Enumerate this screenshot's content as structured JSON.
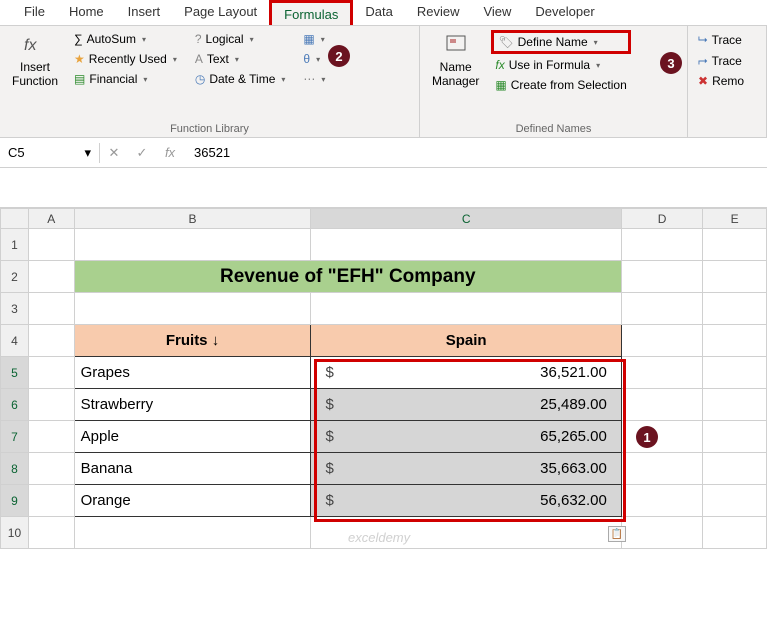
{
  "tabs": [
    "File",
    "Home",
    "Insert",
    "Page Layout",
    "Formulas",
    "Data",
    "Review",
    "View",
    "Developer"
  ],
  "activeTab": "Formulas",
  "ribbon": {
    "insertFunction": "Insert\nFunction",
    "lib": {
      "autosum": "AutoSum",
      "recent": "Recently Used",
      "financial": "Financial",
      "logical": "Logical",
      "text": "Text",
      "datetime": "Date & Time",
      "lookup": "",
      "more": "",
      "groupLabel": "Function Library"
    },
    "names": {
      "manager": "Name\nManager",
      "define": "Define Name",
      "useInFormula": "Use in Formula",
      "createFrom": "Create from Selection",
      "groupLabel": "Defined Names"
    },
    "audit": {
      "trace1": "Trace",
      "trace2": "Trace",
      "remove": "Remo"
    }
  },
  "formulaBar": {
    "nameBox": "C5",
    "value": "36521"
  },
  "columns": [
    "A",
    "B",
    "C",
    "D",
    "E"
  ],
  "rows": [
    "1",
    "2",
    "3",
    "4",
    "5",
    "6",
    "7",
    "8",
    "9",
    "10"
  ],
  "sheet": {
    "title": "Revenue of \"EFH\" Company",
    "headerFruits": "Fruits ↓",
    "headerSpain": "Spain",
    "data": [
      {
        "fruit": "Grapes",
        "value": "36,521.00"
      },
      {
        "fruit": "Strawberry",
        "value": "25,489.00"
      },
      {
        "fruit": "Apple",
        "value": "65,265.00"
      },
      {
        "fruit": "Banana",
        "value": "35,663.00"
      },
      {
        "fruit": "Orange",
        "value": "56,632.00"
      }
    ],
    "currency": "$"
  },
  "watermark": "exceldemy",
  "callouts": {
    "c1": "1",
    "c2": "2",
    "c3": "3"
  }
}
